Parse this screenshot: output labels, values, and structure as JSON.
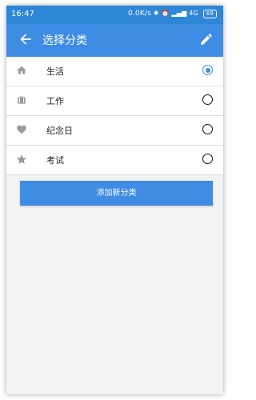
{
  "status_bar": {
    "time": "16:47",
    "network_speed": "0.0K/s",
    "network_type": "4G",
    "battery": "69"
  },
  "app_bar": {
    "title": "选择分类",
    "back_icon": "arrow-left-icon",
    "edit_icon": "pencil-icon"
  },
  "categories": [
    {
      "label": "生活",
      "icon": "home-icon",
      "selected": true
    },
    {
      "label": "工作",
      "icon": "briefcase-icon",
      "selected": false
    },
    {
      "label": "纪念日",
      "icon": "heart-icon",
      "selected": false
    },
    {
      "label": "考试",
      "icon": "star-icon",
      "selected": false
    }
  ],
  "add_button": {
    "label": "添加新分类"
  },
  "colors": {
    "status_bar": "#2d86d6",
    "app_bar": "#3e8ce3",
    "accent": "#3e8ce3",
    "background": "#f2f2f2",
    "icon_gray": "#9b9b9b"
  }
}
